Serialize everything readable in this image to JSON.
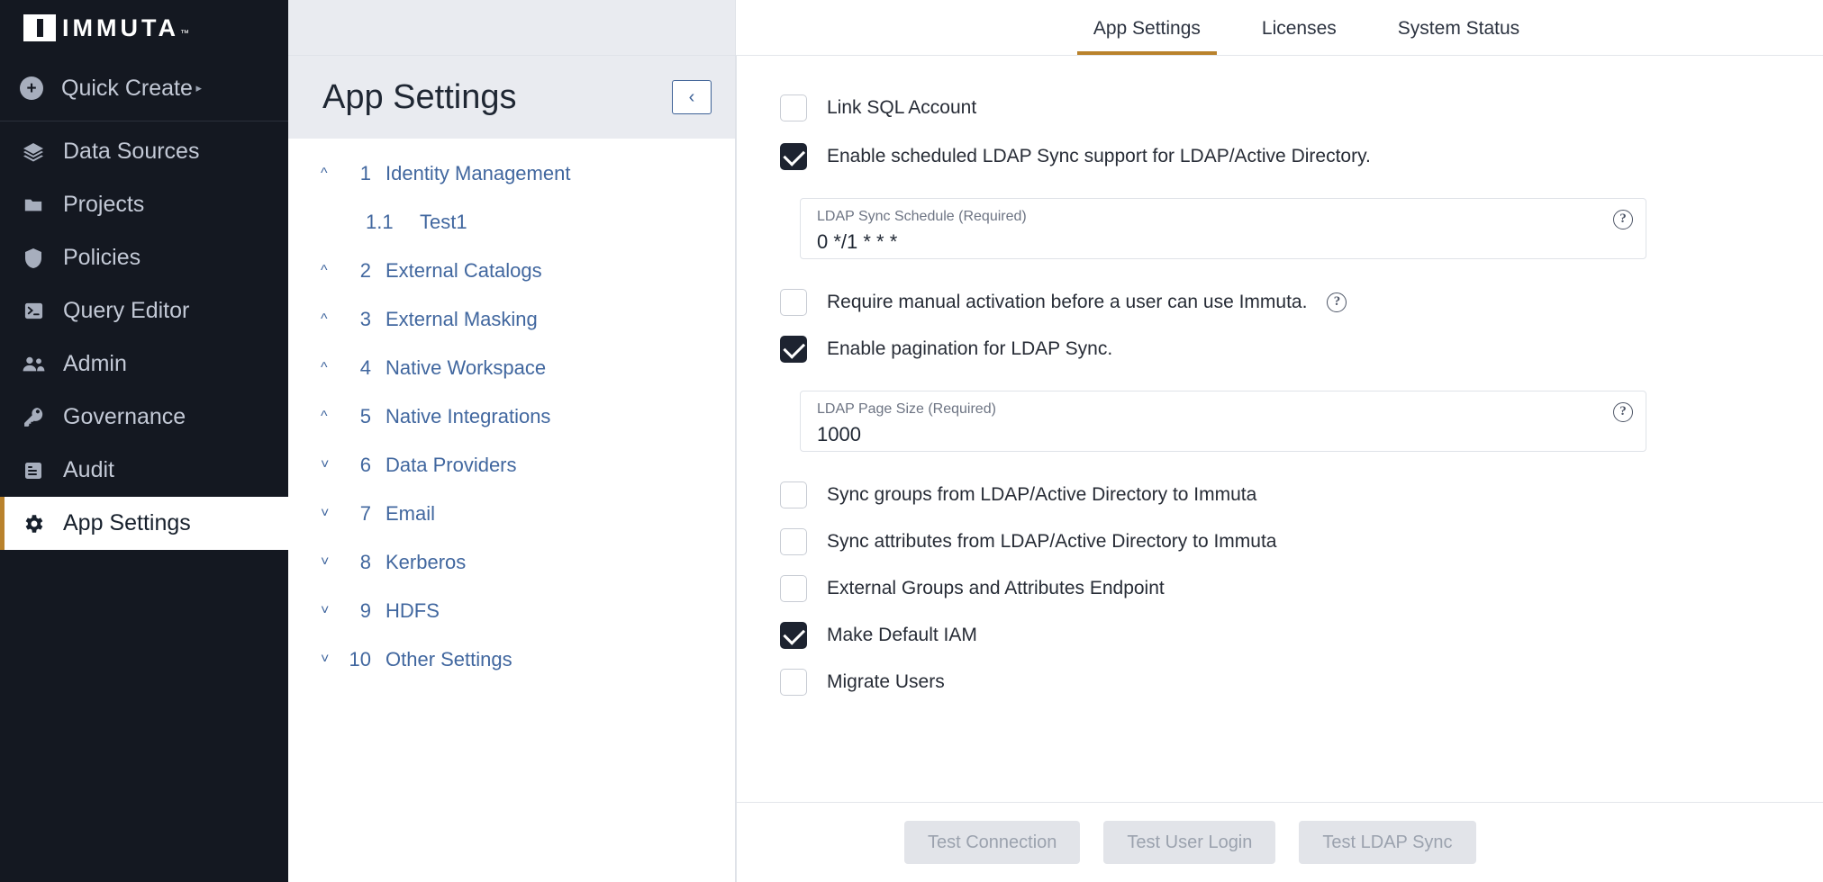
{
  "brand": {
    "name": "IMMUTA",
    "trademark": "™",
    "accent": "#b9822c",
    "sidebar_bg": "#141821"
  },
  "sidebar": {
    "quick_create": {
      "label": "Quick Create",
      "icon": "plus-circle-icon",
      "arrow": "▸"
    },
    "items": [
      {
        "label": "Data Sources",
        "icon": "layers-icon",
        "active": false
      },
      {
        "label": "Projects",
        "icon": "folder-icon",
        "active": false
      },
      {
        "label": "Policies",
        "icon": "shield-icon",
        "active": false
      },
      {
        "label": "Query Editor",
        "icon": "terminal-icon",
        "active": false
      },
      {
        "label": "Admin",
        "icon": "users-icon",
        "active": false
      },
      {
        "label": "Governance",
        "icon": "key-icon",
        "active": false
      },
      {
        "label": "Audit",
        "icon": "document-icon",
        "active": false
      },
      {
        "label": "App Settings",
        "icon": "gear-icon",
        "active": true
      }
    ]
  },
  "navpanel": {
    "title": "App Settings",
    "collapse_icon": "‹",
    "items": [
      {
        "chevron": "^",
        "num": "1",
        "label": "Identity Management",
        "sub": false
      },
      {
        "chevron": "",
        "num": "1.1",
        "label": "Test1",
        "sub": true
      },
      {
        "chevron": "^",
        "num": "2",
        "label": "External Catalogs",
        "sub": false
      },
      {
        "chevron": "^",
        "num": "3",
        "label": "External Masking",
        "sub": false
      },
      {
        "chevron": "^",
        "num": "4",
        "label": "Native Workspace",
        "sub": false
      },
      {
        "chevron": "^",
        "num": "5",
        "label": "Native Integrations",
        "sub": false
      },
      {
        "chevron": "˅",
        "num": "6",
        "label": "Data Providers",
        "sub": false
      },
      {
        "chevron": "˅",
        "num": "7",
        "label": "Email",
        "sub": false
      },
      {
        "chevron": "˅",
        "num": "8",
        "label": "Kerberos",
        "sub": false
      },
      {
        "chevron": "˅",
        "num": "9",
        "label": "HDFS",
        "sub": false
      },
      {
        "chevron": "˅",
        "num": "10",
        "label": "Other Settings",
        "sub": false
      }
    ]
  },
  "tabs": [
    {
      "label": "App Settings",
      "active": true
    },
    {
      "label": "Licenses",
      "active": false
    },
    {
      "label": "System Status",
      "active": false
    }
  ],
  "form": {
    "link_sql_account": {
      "label": "Link SQL Account",
      "checked": false
    },
    "enable_scheduled_sync": {
      "label": "Enable scheduled LDAP Sync support for LDAP/Active Directory.",
      "checked": true
    },
    "ldap_sync_schedule": {
      "label": "LDAP Sync Schedule (Required)",
      "value": "0 */1 * * *",
      "help": "?"
    },
    "require_manual": {
      "label": "Require manual activation before a user can use Immuta.",
      "checked": false,
      "help": "?"
    },
    "enable_pagination": {
      "label": "Enable pagination for LDAP Sync.",
      "checked": true
    },
    "ldap_page_size": {
      "label": "LDAP Page Size (Required)",
      "value": "1000",
      "help": "?"
    },
    "sync_groups": {
      "label": "Sync groups from LDAP/Active Directory to Immuta",
      "checked": false
    },
    "sync_attributes": {
      "label": "Sync attributes from LDAP/Active Directory to Immuta",
      "checked": false
    },
    "external_groups_endpoint": {
      "label": "External Groups and Attributes Endpoint",
      "checked": false
    },
    "make_default_iam": {
      "label": "Make Default IAM",
      "checked": true
    },
    "migrate_users": {
      "label": "Migrate Users",
      "checked": false
    }
  },
  "footer": {
    "buttons": [
      {
        "label": "Test Connection",
        "disabled": true
      },
      {
        "label": "Test User Login",
        "disabled": true
      },
      {
        "label": "Test LDAP Sync",
        "disabled": true
      }
    ]
  }
}
